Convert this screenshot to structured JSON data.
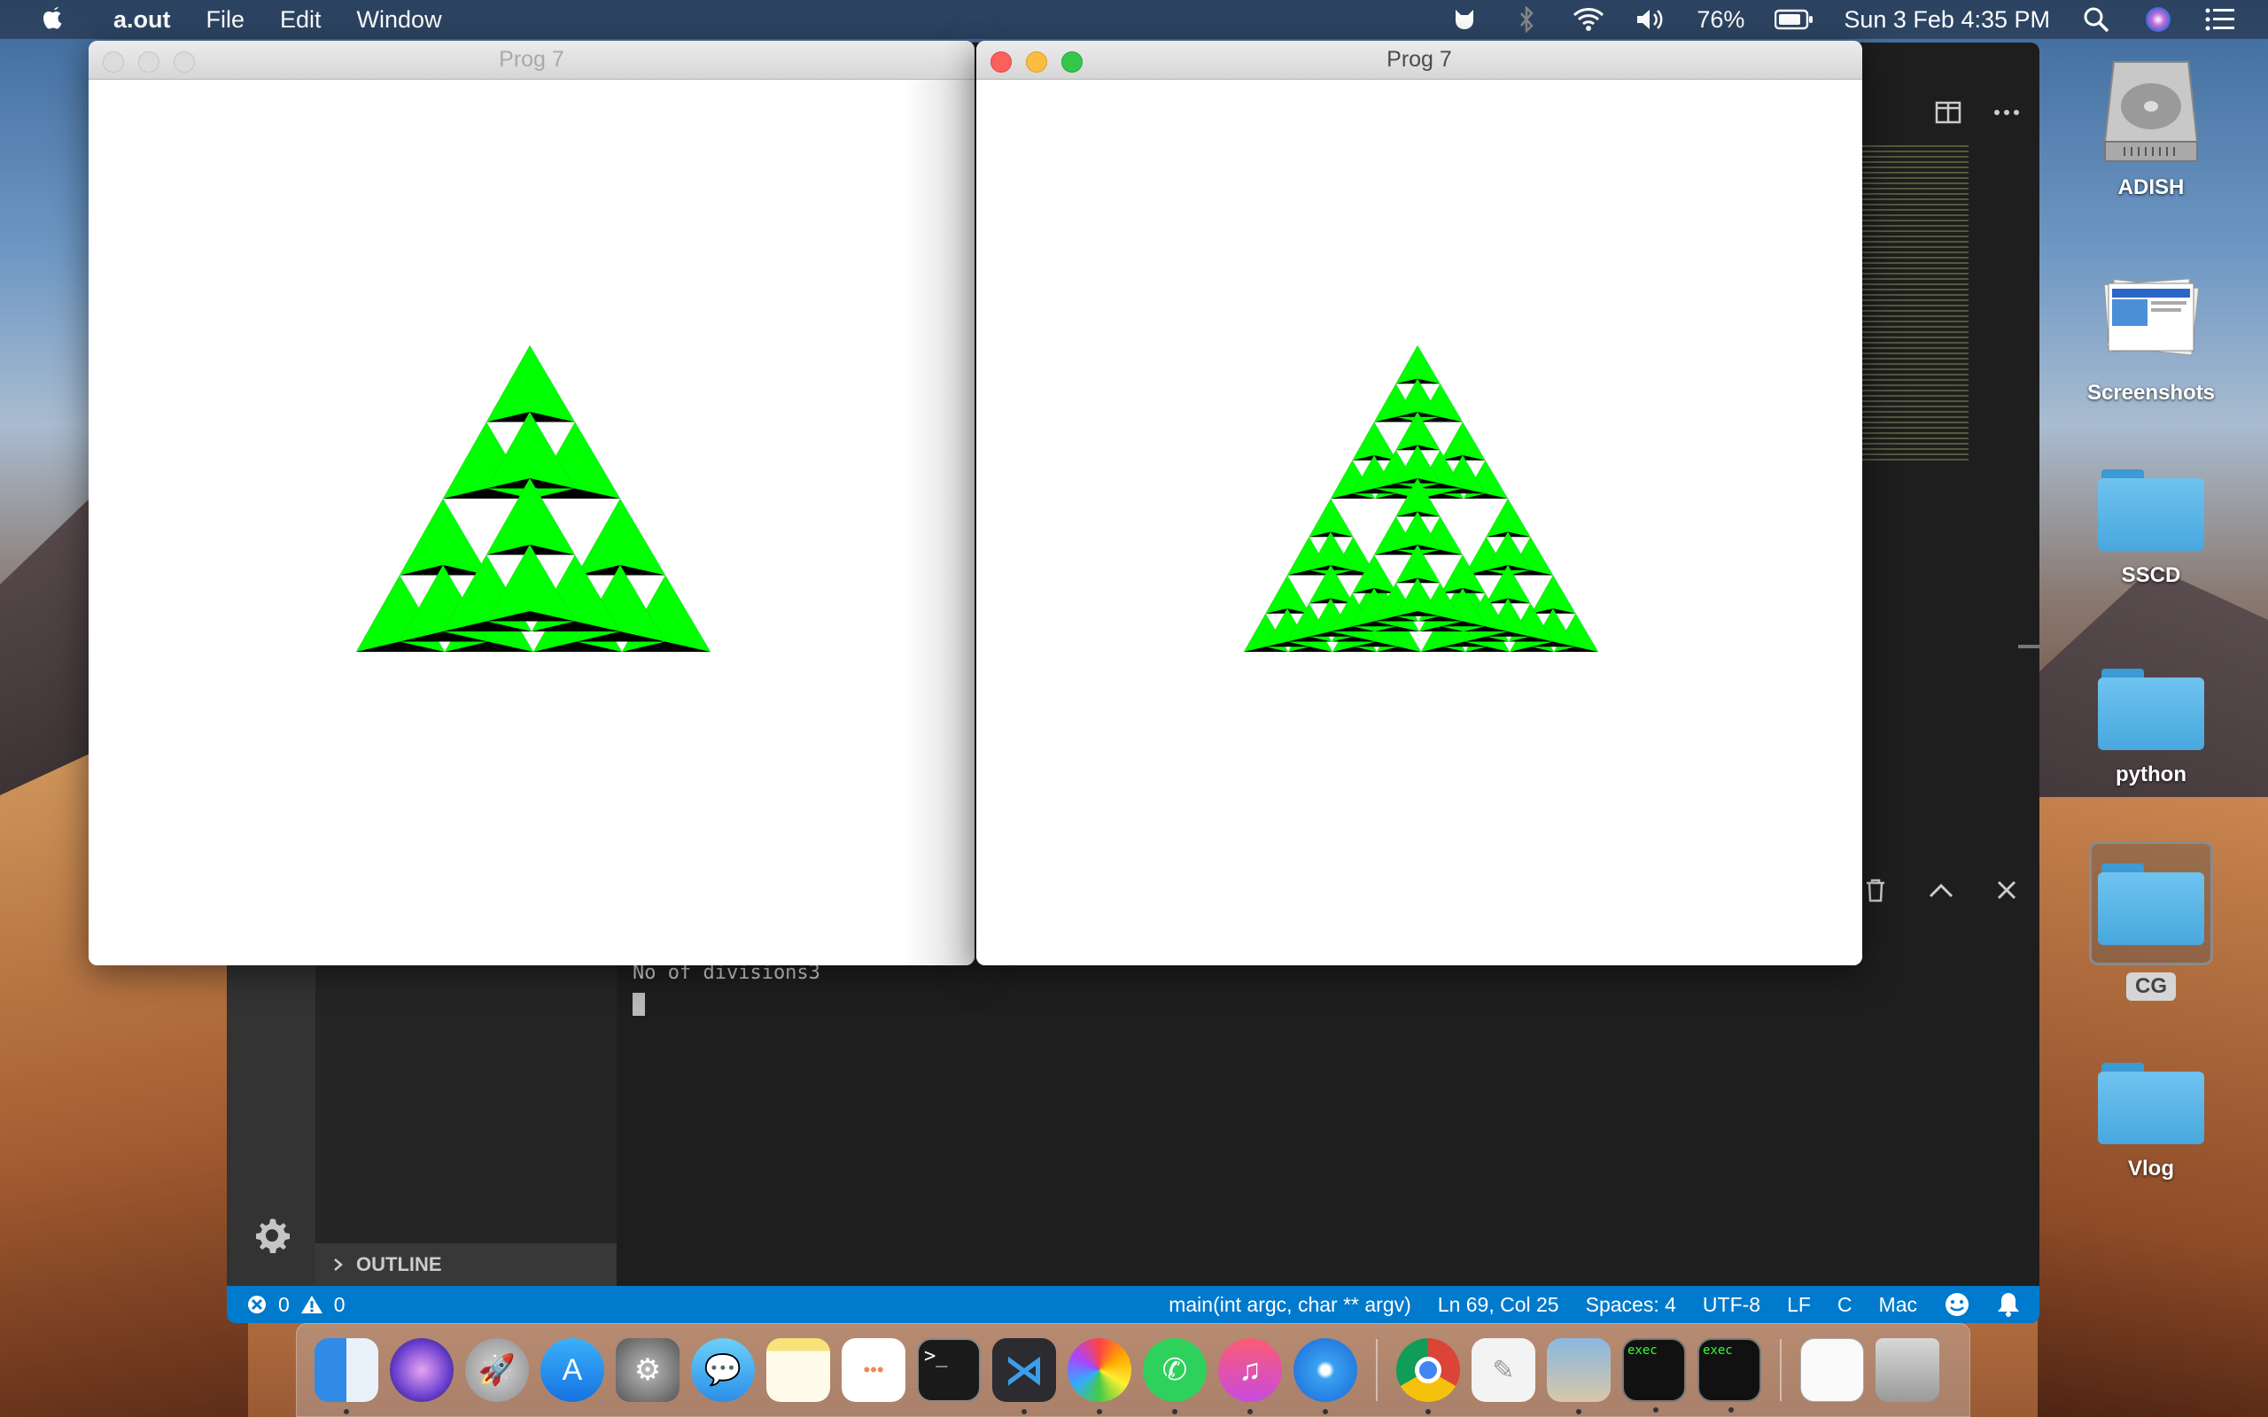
{
  "menubar": {
    "app_name": "a.out",
    "menus": [
      "File",
      "Edit",
      "Window"
    ],
    "battery": "76%",
    "datetime": "Sun 3 Feb  4:35 PM"
  },
  "windows": {
    "left": {
      "title": "Prog 7",
      "divisions": 2
    },
    "right": {
      "title": "Prog 7",
      "divisions": 3
    }
  },
  "fractal_colors": {
    "red": "#ff0000",
    "green": "#00ff00",
    "blue": "#0000ff",
    "black": "#000000"
  },
  "vscode": {
    "terminal_output": "No of divisions3",
    "outline_label": "OUTLINE",
    "status": {
      "errors": "0",
      "warnings": "0",
      "function": "main(int argc, char ** argv)",
      "position": "Ln 69, Col 25",
      "spaces": "Spaces: 4",
      "encoding": "UTF-8",
      "eol": "LF",
      "language": "C",
      "platform": "Mac"
    }
  },
  "desktop": {
    "icons": [
      {
        "label": "ADISH",
        "kind": "drive-icon"
      },
      {
        "label": "Screenshots",
        "kind": "screenshots-folder-icon"
      },
      {
        "label": "SSCD",
        "kind": "folder-icon"
      },
      {
        "label": "python",
        "kind": "folder-icon"
      },
      {
        "label": "CG",
        "kind": "folder-icon"
      },
      {
        "label": "Vlog",
        "kind": "folder-icon"
      }
    ]
  },
  "dock": {
    "apps": [
      "finder-icon",
      "siri-icon",
      "launchpad-icon",
      "app-store-icon",
      "system-preferences-icon",
      "messages-icon",
      "notes-icon",
      "reminders-icon",
      "terminal-icon",
      "vscode-icon",
      "photos-icon",
      "whatsapp-icon",
      "itunes-icon",
      "safari-icon",
      "chrome-icon",
      "textedit-icon",
      "preview-icon",
      "exec-terminal-icon",
      "exec-terminal-icon",
      "document-icon",
      "trash-icon"
    ],
    "exec_label": "exec"
  }
}
